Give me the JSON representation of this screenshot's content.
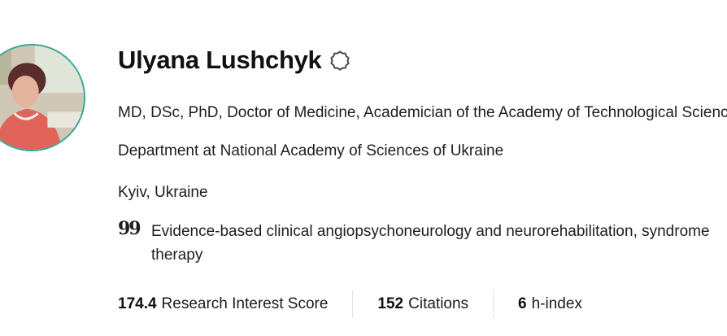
{
  "profile": {
    "name": "Ulyana Lushchyk",
    "degrees": "MD, DSc, PhD, Doctor of Medicine, Academician of the Academy of Technological Sciences of Ukraine",
    "department": "Department at National Academy of Sciences of Ukraine",
    "location": "Kyiv, Ukraine",
    "research_interest": "Evidence-based clinical angiopsychoneurology and neurorehabilitation, syndrome therapy",
    "badge_icon": "verified-outline-icon",
    "quote_icon": "quote-icon"
  },
  "stats": [
    {
      "value": "174.4",
      "label": "Research Interest Score"
    },
    {
      "value": "152",
      "label": "Citations"
    },
    {
      "value": "6",
      "label": "h-index"
    }
  ],
  "colors": {
    "avatar_ring": "#3aa59a",
    "text": "#1e1e1e",
    "divider": "#e2e2e2"
  }
}
